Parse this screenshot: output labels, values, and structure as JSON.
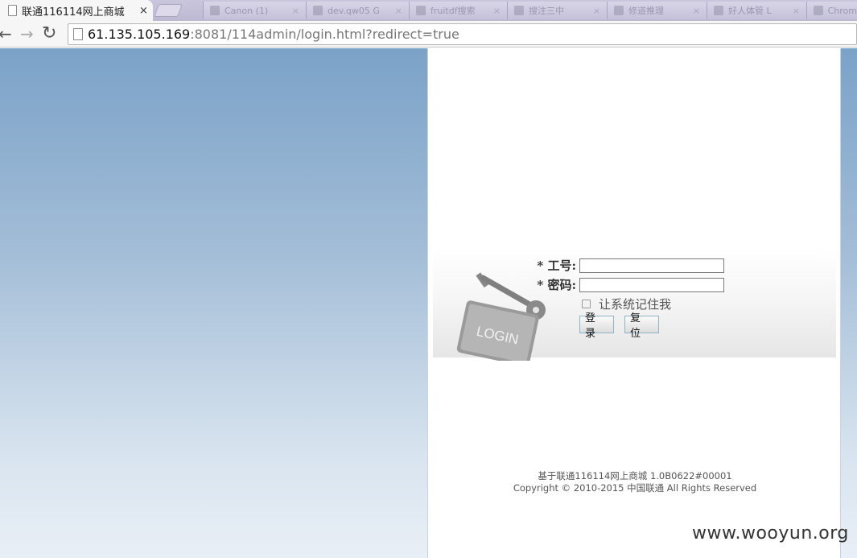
{
  "browser": {
    "active_tab": {
      "title": "联通116114网上商城",
      "close_glyph": "×"
    },
    "background_tabs": [
      {
        "label": "Canon (1)",
        "x": "×"
      },
      {
        "label": "dev.qw05 G",
        "x": "×"
      },
      {
        "label": "fruitdf搜索",
        "x": "×"
      },
      {
        "label": "搜注三中",
        "x": "×"
      },
      {
        "label": "修道推理",
        "x": "×"
      },
      {
        "label": "好人体管 L",
        "x": "×"
      },
      {
        "label": "Chrom",
        "x": ""
      }
    ],
    "nav": {
      "back": "←",
      "forward": "→",
      "reload": "↻"
    },
    "url": {
      "host": "61.135.105.169",
      "rest": ":8081/114admin/login.html?redirect=true"
    }
  },
  "login": {
    "employee_id_label": "* 工号:",
    "employee_id_value": "",
    "password_label": "* 密码:",
    "password_value": "",
    "remember_label": "让系统记住我",
    "remember_checked": false,
    "login_button": "登录",
    "reset_button": "复位",
    "art_text": "LOGIN"
  },
  "footer": {
    "line1": "基于联通116114网上商城 1.0B0622#00001",
    "line2": "Copyright © 2010-2015 中国联通 All Rights Reserved"
  },
  "watermark": "www.wooyun.org",
  "colors": {
    "page_top": "#7ba2c8",
    "page_bottom": "#e9eff6",
    "button_border": "#8fb3c9"
  }
}
